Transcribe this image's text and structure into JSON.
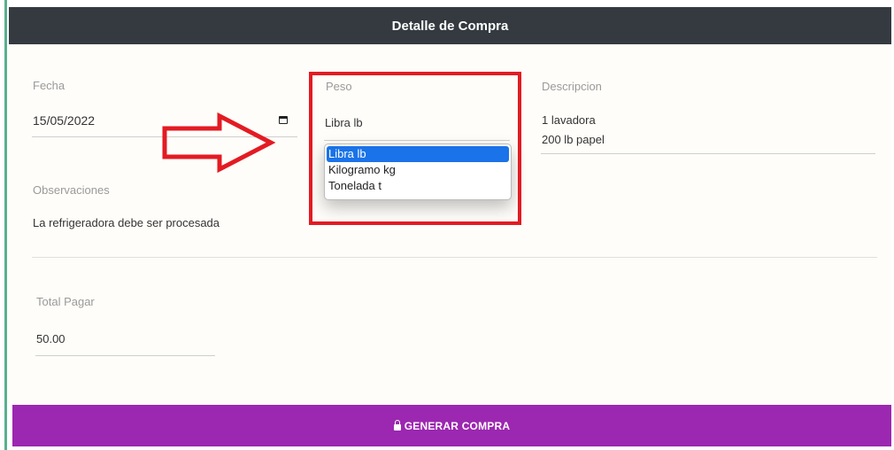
{
  "header": {
    "title": "Detalle de Compra"
  },
  "fecha": {
    "label": "Fecha",
    "value": "15/05/2022"
  },
  "peso": {
    "label": "Peso",
    "value": "Libra lb",
    "options": [
      "Libra lb",
      "Kilogramo kg",
      "Tonelada t"
    ],
    "selected_index": 0
  },
  "descripcion": {
    "label": "Descripcion",
    "lines": [
      "1 lavadora",
      "200 lb papel"
    ]
  },
  "observaciones": {
    "label": "Observaciones",
    "value": "La refrigeradora debe ser procesada"
  },
  "total": {
    "label": "Total Pagar",
    "value": "50.00"
  },
  "actions": {
    "generar_label": "GENERAR COMPRA"
  },
  "colors": {
    "header_bg": "#343a40",
    "button_bg": "#9c27b0",
    "highlight": "#e31b23",
    "selected_option": "#1a73e8",
    "left_accent": "#58b08e"
  },
  "icons": {
    "calendar": "calendar-icon",
    "lock": "lock-icon",
    "annotation_arrow": "arrow-right-icon"
  }
}
